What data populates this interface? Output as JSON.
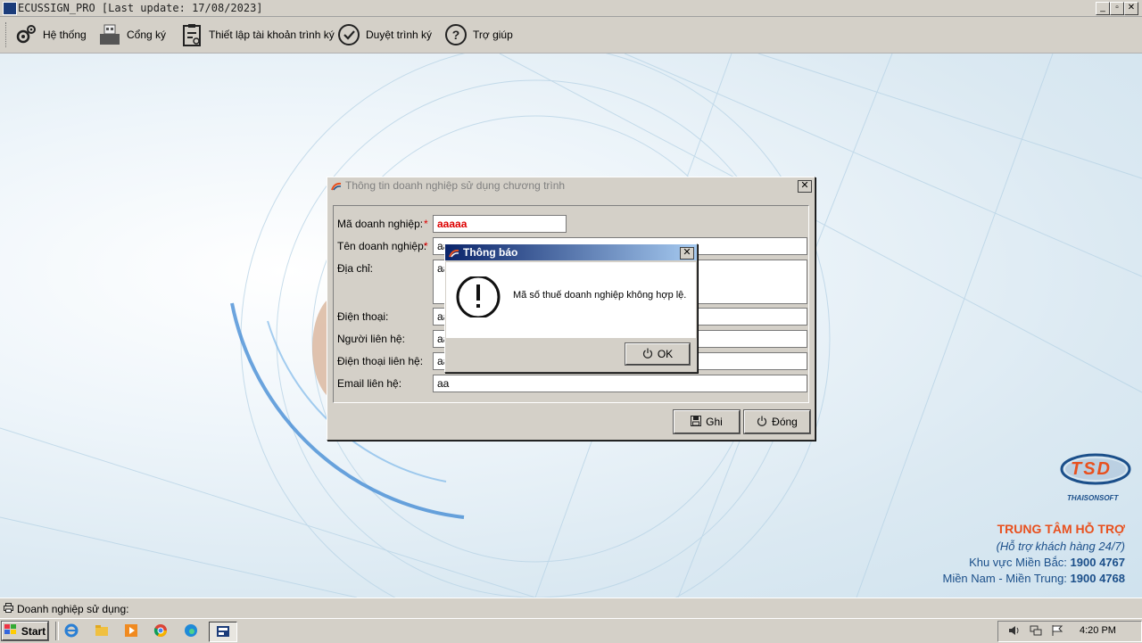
{
  "window": {
    "title": "ECUSSIGN_PRO [Last update: 17/08/2023]",
    "minimize": "_",
    "restore": "▫",
    "close": "✕"
  },
  "toolbar": [
    {
      "label": "Hệ thống",
      "icon": "gears-icon"
    },
    {
      "label": "Cổng ký",
      "icon": "usb-token-icon"
    },
    {
      "label": "Thiết lập tài khoản trình ký",
      "icon": "clipboard-settings-icon"
    },
    {
      "label": "Duyệt trình ký",
      "icon": "check-circle-icon"
    },
    {
      "label": "Trợ giúp",
      "icon": "question-circle-icon"
    }
  ],
  "company_dialog": {
    "title": "Thông tin doanh nghiệp sử dụng chương trình",
    "fields": {
      "ma_dn": {
        "label": "Mã doanh nghiệp:",
        "value": "aaaaa",
        "required": "*"
      },
      "ten_dn": {
        "label": "Tên doanh nghiệp:",
        "value": "aa",
        "required": "*"
      },
      "dia_chi": {
        "label": "Địa chỉ:",
        "value": "aa"
      },
      "dien_thoai": {
        "label": "Điện thoại:",
        "value": "aa"
      },
      "nguoi_lien_he": {
        "label": "Người liên hệ:",
        "value": "aa"
      },
      "dt_lien_he": {
        "label": "Điện thoại liên hệ:",
        "value": "aa"
      },
      "email": {
        "label": "Email liên hệ:",
        "value": "aa"
      }
    },
    "save_label": "Ghi",
    "close_label": "Đóng"
  },
  "alert": {
    "title": "Thông báo",
    "message": "Mã số thuế doanh nghiệp không hợp lệ.",
    "ok_label": "OK"
  },
  "support": {
    "logo": "TSD",
    "brand": "THAISONSOFT",
    "heading": "TRUNG TÂM HỖ TRỢ",
    "sub": "(Hỗ trợ khách hàng 24/7)",
    "north_label": "Khu vực Miền Bắc:",
    "north_phone": "1900 4767",
    "south_label": "Miền Nam - Miền Trung:",
    "south_phone": "1900 4768"
  },
  "statusbar": {
    "text": "Doanh nghiệp sử dụng:"
  },
  "taskbar": {
    "start": "Start",
    "clock": "4:20 PM"
  },
  "colors": {
    "accent": "#e8501e",
    "blue": "#1b4f8a",
    "dialog_title_blue": "#0a246a"
  }
}
